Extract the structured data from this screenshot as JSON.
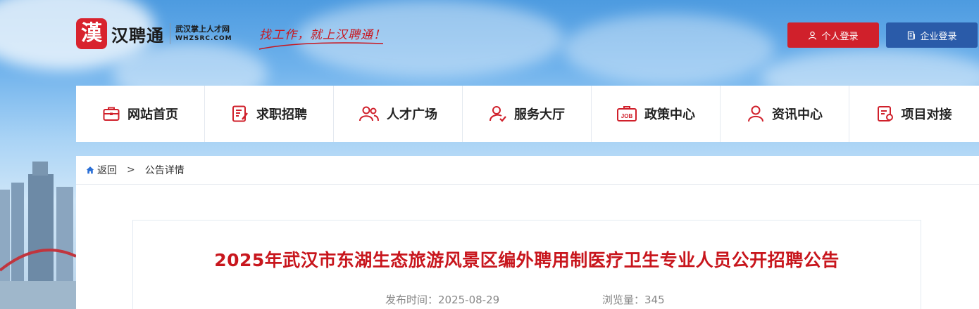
{
  "header": {
    "logo_char": "漢",
    "logo_name": "汉聘通",
    "logo_sub_cn": "武汉掌上人才网",
    "logo_sub_en": "WHZSRC.COM",
    "slogan": "找工作，就上汉聘通！",
    "personal_login": "个人登录",
    "company_login": "企业登录"
  },
  "nav": {
    "items": [
      {
        "label": "网站首页",
        "icon": "briefcase-icon"
      },
      {
        "label": "求职招聘",
        "icon": "resume-icon"
      },
      {
        "label": "人才广场",
        "icon": "people-icon"
      },
      {
        "label": "服务大厅",
        "icon": "service-icon"
      },
      {
        "label": "政策中心",
        "icon": "job-icon"
      },
      {
        "label": "资讯中心",
        "icon": "person-icon"
      },
      {
        "label": "项目对接",
        "icon": "project-icon"
      }
    ]
  },
  "breadcrumb": {
    "back": "返回",
    "separator": ">",
    "current": "公告详情"
  },
  "article": {
    "title": "2025年武汉市东湖生态旅游风景区编外聘用制医疗卫生专业人员公开招聘公告",
    "date_label": "发布时间：2025-08-29",
    "views_label": "浏览量：345"
  },
  "colors": {
    "brand_red": "#d0202b",
    "brand_blue": "#2a5ba9",
    "title_red": "#c8161d"
  }
}
